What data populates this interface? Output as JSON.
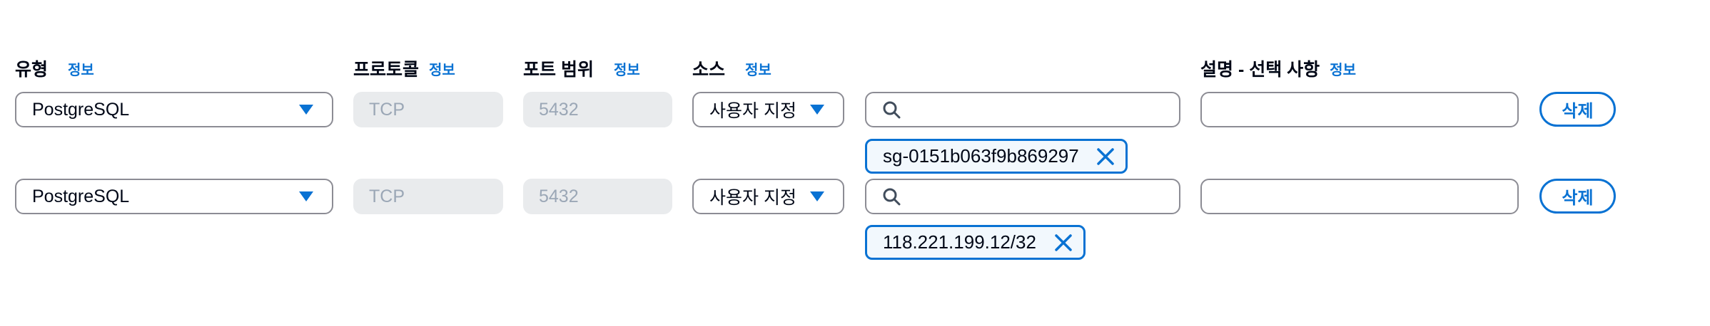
{
  "headers": {
    "type": {
      "label": "유형",
      "info": "정보"
    },
    "protocol": {
      "label": "프로토콜",
      "info": "정보"
    },
    "port_range": {
      "label": "포트 범위",
      "info": "정보"
    },
    "source": {
      "label": "소스",
      "info": "정보"
    },
    "description": {
      "label": "설명 - 선택 사항",
      "info": "정보"
    }
  },
  "rules": [
    {
      "type": "PostgreSQL",
      "protocol": "TCP",
      "port_range": "5432",
      "source_type": "사용자 지정",
      "search_value": "",
      "source_token": "sg-0151b063f9b869297",
      "description": "",
      "delete_label": "삭제"
    },
    {
      "type": "PostgreSQL",
      "protocol": "TCP",
      "port_range": "5432",
      "source_type": "사용자 지정",
      "search_value": "",
      "source_token": "118.221.199.12/32",
      "description": "",
      "delete_label": "삭제"
    }
  ],
  "icons": {
    "dropdown": "caret-down-icon",
    "search": "search-icon",
    "remove": "close-icon"
  },
  "colors": {
    "accent": "#0972d3",
    "text": "#000716",
    "disabled_bg": "#e9ebed",
    "disabled_text": "#9ba7b6",
    "border": "#8c8c94",
    "token_bg": "#f2f8fd"
  }
}
